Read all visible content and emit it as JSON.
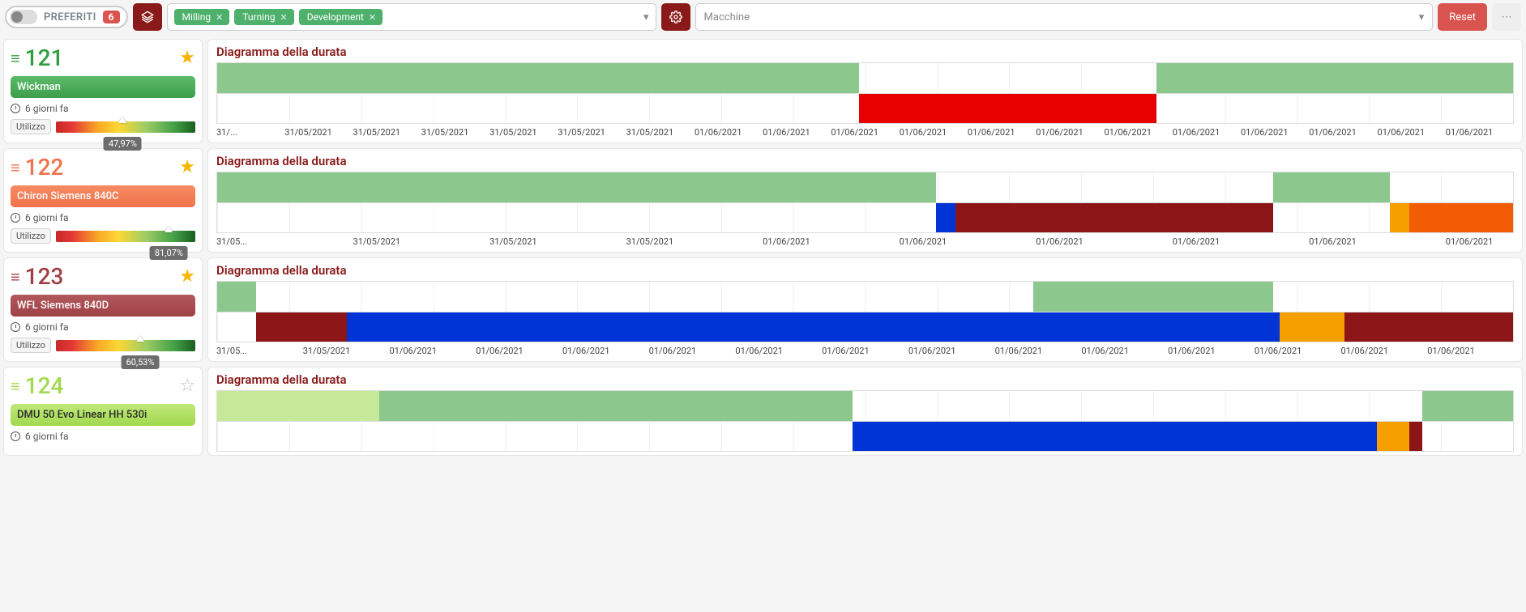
{
  "toolbar": {
    "fav_label": "PREFERITI",
    "fav_count": "6",
    "tags": [
      "Milling",
      "Turning",
      "Development"
    ],
    "machine_placeholder": "Macchine",
    "reset_label": "Reset"
  },
  "chart_title": "Diagramma della durata",
  "utilizzo_label": "Utilizzo",
  "machines": [
    {
      "id": "121",
      "name": "Wickman",
      "color_class": "g-green",
      "row_class": "c121",
      "favorite": true,
      "last_seen": "6 giorni fa",
      "utilization_pct": 47.97,
      "utilization_label": "47,97%",
      "axis": [
        "31/...",
        "31/05/2021",
        "31/05/2021",
        "31/05/2021",
        "31/05/2021",
        "31/05/2021",
        "31/05/2021",
        "01/06/2021",
        "01/06/2021",
        "01/06/2021",
        "01/06/2021",
        "01/06/2021",
        "01/06/2021",
        "01/06/2021",
        "01/06/2021",
        "01/06/2021",
        "01/06/2021",
        "01/06/2021",
        "01/06/2021"
      ],
      "chart_data": {
        "type": "bar",
        "tracks": [
          {
            "name": "state-top",
            "segments": [
              {
                "start": 0,
                "end": 49.5,
                "color": "green"
              },
              {
                "start": 72.5,
                "end": 100,
                "color": "green"
              }
            ]
          },
          {
            "name": "state-bottom",
            "segments": [
              {
                "start": 49.5,
                "end": 72.5,
                "color": "red"
              }
            ]
          }
        ]
      }
    },
    {
      "id": "122",
      "name": "Chiron Siemens 840C",
      "color_class": "g-orange",
      "row_class": "c122",
      "favorite": true,
      "last_seen": "6 giorni fa",
      "utilization_pct": 81.07,
      "utilization_label": "81,07%",
      "axis": [
        "31/05...",
        "",
        "31/05/2021",
        "",
        "31/05/2021",
        "",
        "31/05/2021",
        "",
        "01/06/2021",
        "",
        "01/06/2021",
        "",
        "01/06/2021",
        "",
        "01/06/2021",
        "",
        "01/06/2021",
        "",
        "01/06/2021"
      ],
      "chart_data": {
        "type": "bar",
        "tracks": [
          {
            "name": "state-top",
            "segments": [
              {
                "start": 0,
                "end": 55.5,
                "color": "green"
              },
              {
                "start": 81.5,
                "end": 90.5,
                "color": "green"
              }
            ]
          },
          {
            "name": "state-bottom",
            "segments": [
              {
                "start": 55.5,
                "end": 57,
                "color": "blue"
              },
              {
                "start": 57,
                "end": 81.5,
                "color": "maroon"
              },
              {
                "start": 90.5,
                "end": 92,
                "color": "orange"
              },
              {
                "start": 92,
                "end": 100,
                "color": "deeporange"
              }
            ]
          }
        ]
      }
    },
    {
      "id": "123",
      "name": "WFL Siemens 840D",
      "color_class": "g-maroon",
      "row_class": "c123",
      "favorite": true,
      "last_seen": "6 giorni fa",
      "utilization_pct": 60.53,
      "utilization_label": "60,53%",
      "axis": [
        "31/05...",
        "31/05/2021",
        "01/06/2021",
        "01/06/2021",
        "01/06/2021",
        "01/06/2021",
        "01/06/2021",
        "01/06/2021",
        "01/06/2021",
        "01/06/2021",
        "01/06/2021",
        "01/06/2021",
        "01/06/2021",
        "01/06/2021",
        "01/06/2021"
      ],
      "chart_data": {
        "type": "bar",
        "tracks": [
          {
            "name": "state-top",
            "segments": [
              {
                "start": 0,
                "end": 3,
                "color": "green"
              },
              {
                "start": 63,
                "end": 81.5,
                "color": "green"
              }
            ]
          },
          {
            "name": "state-bottom",
            "segments": [
              {
                "start": 3,
                "end": 10,
                "color": "maroon"
              },
              {
                "start": 10,
                "end": 63,
                "color": "blue"
              },
              {
                "start": 63,
                "end": 82,
                "color": "blue"
              },
              {
                "start": 82,
                "end": 87,
                "color": "orange"
              },
              {
                "start": 87,
                "end": 100,
                "color": "maroon"
              }
            ]
          }
        ]
      }
    },
    {
      "id": "124",
      "name": "DMU 50 Evo Linear HH 530i",
      "color_class": "g-lime",
      "row_class": "c124",
      "favorite": false,
      "last_seen": "6 giorni fa",
      "utilization_pct": null,
      "utilization_label": "",
      "axis": [],
      "chart_data": {
        "type": "bar",
        "tracks": [
          {
            "name": "state-top",
            "segments": [
              {
                "start": 0,
                "end": 12.5,
                "color": "lime"
              },
              {
                "start": 12.5,
                "end": 49,
                "color": "green"
              },
              {
                "start": 93,
                "end": 100,
                "color": "green"
              }
            ]
          },
          {
            "name": "state-bottom",
            "segments": [
              {
                "start": 49,
                "end": 89.5,
                "color": "blue"
              },
              {
                "start": 89.5,
                "end": 92,
                "color": "orange"
              },
              {
                "start": 92,
                "end": 93,
                "color": "maroon"
              }
            ]
          }
        ]
      }
    }
  ]
}
